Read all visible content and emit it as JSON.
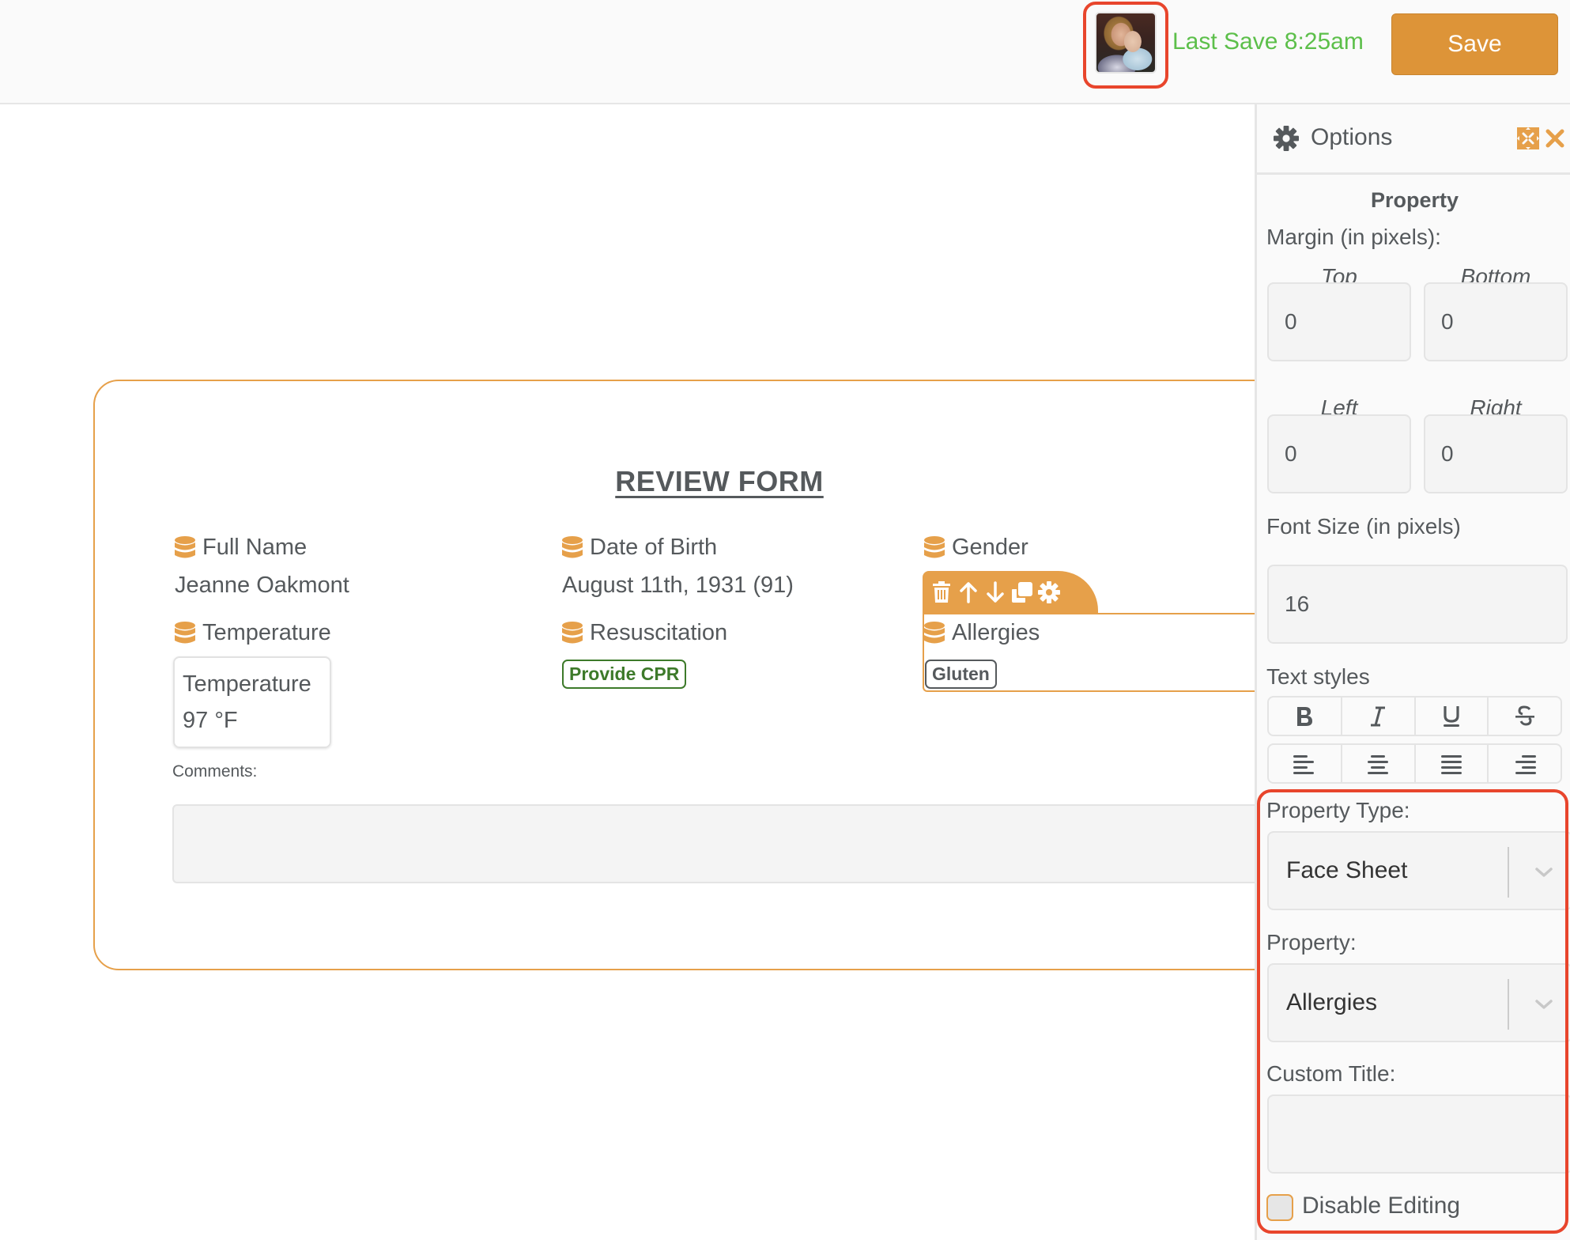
{
  "topbar": {
    "avatar_alt": "user-avatar",
    "last_save": "Last Save 8:25am",
    "save_label": "Save"
  },
  "colors": {
    "accent": "#e6a04a",
    "save_button": "#dd9438",
    "last_save_text": "#5cbf4a",
    "highlight": "#e8452c",
    "badge_green": "#3d7a2a",
    "text": "#55595c"
  },
  "form": {
    "title": "REVIEW FORM",
    "fields": [
      {
        "label": "Full Name",
        "value": "Jeanne Oakmont",
        "icon": "database-icon"
      },
      {
        "label": "Date of Birth",
        "value": "August 11th, 1931 (91)",
        "icon": "database-icon"
      },
      {
        "label": "Gender",
        "value": "",
        "icon": "database-icon"
      },
      {
        "label": "Temperature",
        "icon": "database-icon",
        "card_title": "Temperature",
        "card_value": "97 °F"
      },
      {
        "label": "Resuscitation",
        "badge": "Provide CPR",
        "icon": "database-icon"
      },
      {
        "label": "Allergies",
        "badge": "Gluten",
        "icon": "database-icon",
        "selected": true
      }
    ],
    "comments_label": "Comments:",
    "comments_value": "",
    "selected_toolbar": [
      "trash-icon",
      "arrow-up-icon",
      "arrow-down-icon",
      "duplicate-icon",
      "gear-icon"
    ]
  },
  "panel": {
    "title": "Options",
    "section_heading": "Property",
    "margin_label": "Margin (in pixels):",
    "margin": {
      "top_label": "Top",
      "top": "0",
      "bottom_label": "Bottom",
      "bottom": "0",
      "left_label": "Left",
      "left": "0",
      "right_label": "Right",
      "right": "0"
    },
    "font_size_label": "Font Size (in pixels)",
    "font_size": "16",
    "text_styles_label": "Text styles",
    "text_styles": [
      "B",
      "I",
      "U",
      "S"
    ],
    "alignments": [
      "align-left",
      "align-center",
      "align-justify",
      "align-right"
    ],
    "property_type_label": "Property Type:",
    "property_type": "Face Sheet",
    "property_label": "Property:",
    "property": "Allergies",
    "custom_title_label": "Custom Title:",
    "custom_title": "",
    "disable_editing_label": "Disable Editing",
    "disable_editing": false
  }
}
